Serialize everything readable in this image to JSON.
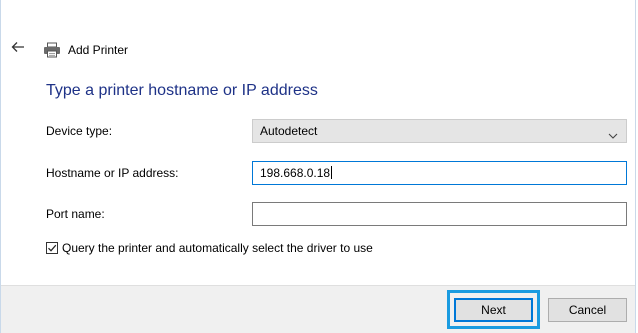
{
  "nav": {
    "back_icon": "arrow-left-icon",
    "printer_icon": "printer-icon",
    "title": "Add Printer"
  },
  "main": {
    "heading": "Type a printer hostname or IP address",
    "device_type": {
      "label": "Device type:",
      "value": "Autodetect",
      "icon": "chevron-down-icon"
    },
    "hostname": {
      "label": "Hostname or IP address:",
      "value": "198.668.0.18"
    },
    "port_name": {
      "label": "Port name:",
      "value": ""
    },
    "query_checkbox": {
      "label": "Query the printer and automatically select the driver to use",
      "checked": true
    }
  },
  "footer": {
    "next_label": "Next",
    "cancel_label": "Cancel"
  },
  "colors": {
    "heading": "#1e3287",
    "highlight": "#1a9be0",
    "focus": "#0078d7",
    "footer_bg": "#f0f0f0"
  }
}
